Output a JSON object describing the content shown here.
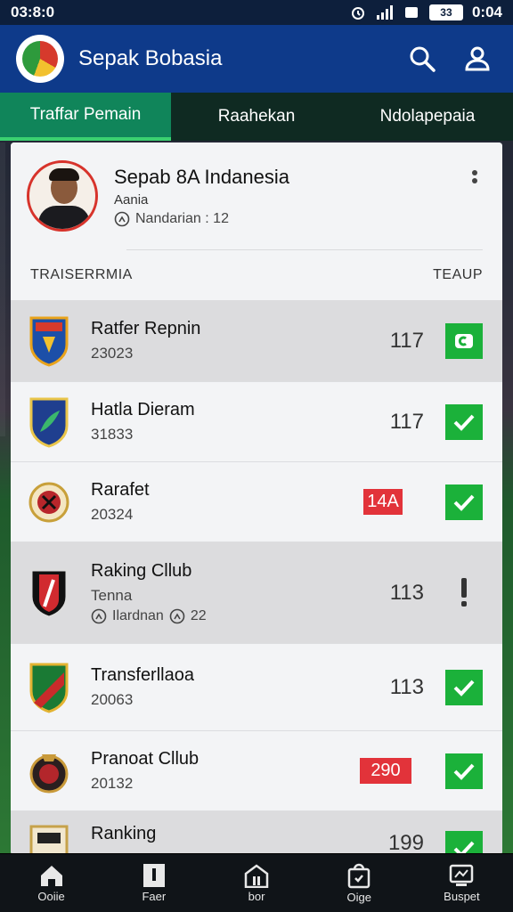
{
  "status_bar": {
    "time": "03:8:0",
    "battery": "33",
    "clock": "0:04"
  },
  "header": {
    "title": "Sepak Bobasia"
  },
  "tabs": [
    {
      "label": "Traffar Pemain",
      "active": true
    },
    {
      "label": "Raahekan",
      "active": false
    },
    {
      "label": "Ndolapepaia",
      "active": false
    }
  ],
  "profile": {
    "name": "Sepab 8A Indanesia",
    "role": "Aania",
    "stat": "Nandarian : 12"
  },
  "columns": {
    "left": "TRAISERRMIA",
    "right": "TEAUP"
  },
  "rows": [
    {
      "name": "Ratfer Repnin",
      "sub": "23023",
      "value": "117",
      "value_style": "plain",
      "action": "check-alt",
      "shaded": true
    },
    {
      "name": "Hatla Dieram",
      "sub": "31833",
      "value": "117",
      "value_style": "plain",
      "action": "check",
      "shaded": false
    },
    {
      "name": "Rarafet",
      "sub": "20324",
      "value": "14A",
      "value_style": "red",
      "action": "check",
      "shaded": false
    },
    {
      "name": "Raking Cllub",
      "sub": "Tenna",
      "sub2": "Ilardnan",
      "sub2_value": "22",
      "value": "113",
      "value_style": "plain",
      "action": "exclaim",
      "shaded": true
    },
    {
      "name": "Transferllaoa",
      "sub": "20063",
      "value": "113",
      "value_style": "plain",
      "action": "check",
      "shaded": false
    },
    {
      "name": "Pranoat Cllub",
      "sub": "20132",
      "value": "290",
      "value_style": "red",
      "action": "check",
      "shaded": false
    },
    {
      "name": "Ranking",
      "sub": "",
      "value": "199",
      "value_style": "plain",
      "action": "check",
      "shaded": true
    }
  ],
  "bottom_nav": [
    {
      "label": "Ooiie",
      "icon": "home-icon"
    },
    {
      "label": "Faer",
      "icon": "card-icon"
    },
    {
      "label": "bor",
      "icon": "building-icon"
    },
    {
      "label": "Oige",
      "icon": "bag-icon"
    },
    {
      "label": "Buspet",
      "icon": "report-icon"
    }
  ],
  "colors": {
    "header": "#0e3a8a",
    "tab_active": "#10855a",
    "check": "#1bb13a",
    "red_badge": "#e2333a"
  }
}
